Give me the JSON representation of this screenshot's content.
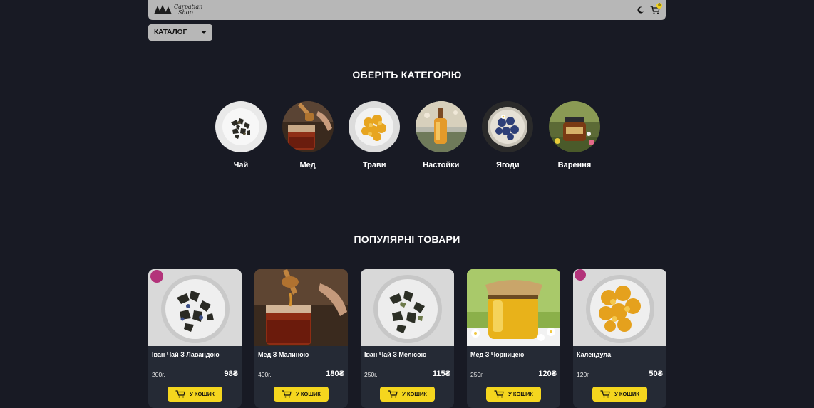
{
  "header": {
    "logo_line1": "Carpatian",
    "logo_line2": "Shop",
    "cart_count": "0"
  },
  "catalog": {
    "label": "КАТАЛОГ"
  },
  "categories_section": {
    "title": "ОБЕРІТЬ КАТЕГОРІЮ",
    "items": [
      {
        "label": "Чай",
        "icon": "tea-leaves-image"
      },
      {
        "label": "Мед",
        "icon": "honey-image"
      },
      {
        "label": "Трави",
        "icon": "herbs-image"
      },
      {
        "label": "Настойки",
        "icon": "tincture-image"
      },
      {
        "label": "Ягоди",
        "icon": "berries-image"
      },
      {
        "label": "Варення",
        "icon": "jam-image"
      }
    ]
  },
  "popular_section": {
    "title": "ПОПУЛЯРНІ ТОВАРИ",
    "products": [
      {
        "name": "Іван Чай З Лавандою",
        "weight": "200г.",
        "price": "98₴",
        "button": "У КОШИК"
      },
      {
        "name": "Мед З Малиною",
        "weight": "400г.",
        "price": "180₴",
        "button": "У КОШИК"
      },
      {
        "name": "Іван Чай З Мелісою",
        "weight": "250г.",
        "price": "115₴",
        "button": "У КОШИК"
      },
      {
        "name": "Мед З Чорницею",
        "weight": "250г.",
        "price": "120₴",
        "button": "У КОШИК"
      },
      {
        "name": "Календула",
        "weight": "120г.",
        "price": "50₴",
        "button": "У КОШИК"
      }
    ]
  },
  "colors": {
    "background": "#181a24",
    "header": "#b7b7b7",
    "card": "#252a35",
    "accent": "#f5d61e"
  }
}
